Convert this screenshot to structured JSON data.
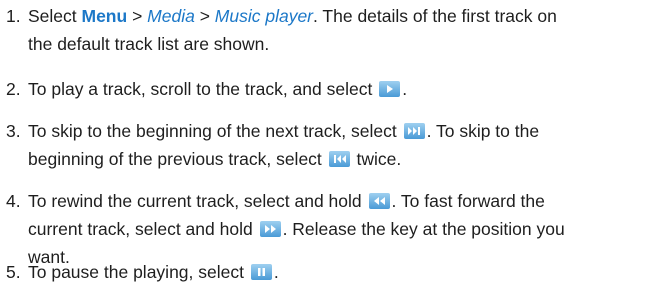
{
  "colors": {
    "link": "#1c78c8",
    "text": "#1e1e1e",
    "button_top": "#9fd0f0",
    "button_bottom": "#4a9ad6"
  },
  "steps": [
    {
      "number": "1.",
      "parts": [
        {
          "text": "Select "
        },
        {
          "text": "Menu"
        },
        {
          "text": " > "
        },
        {
          "text": "Media"
        },
        {
          "text": " > "
        },
        {
          "text": "Music player"
        },
        {
          "text": ". The details of the first track on"
        },
        {
          "text": "the default track list are shown."
        }
      ]
    },
    {
      "number": "2.",
      "parts": [
        {
          "text": "To play a track, scroll to the track, and select "
        },
        {
          "text": "."
        }
      ],
      "icon": "play-icon"
    },
    {
      "number": "3.",
      "parts": [
        {
          "text": "To skip to the beginning of the next track, select "
        },
        {
          "text": ". To skip to the"
        },
        {
          "text": "beginning of the previous track, select "
        },
        {
          "text": " twice."
        }
      ],
      "icons": [
        "skip-next-icon",
        "skip-previous-icon"
      ]
    },
    {
      "number": "4.",
      "parts": [
        {
          "text": "To rewind the current track, select and hold "
        },
        {
          "text": ". To fast forward the"
        },
        {
          "text": "current track, select and hold "
        },
        {
          "text": ". Release the key at the position you"
        },
        {
          "text": "want."
        }
      ],
      "icons": [
        "rewind-icon",
        "fast-forward-icon"
      ]
    },
    {
      "number": "5.",
      "parts": [
        {
          "text": "To pause the playing, select "
        },
        {
          "text": "."
        }
      ],
      "icon": "pause-icon"
    }
  ]
}
